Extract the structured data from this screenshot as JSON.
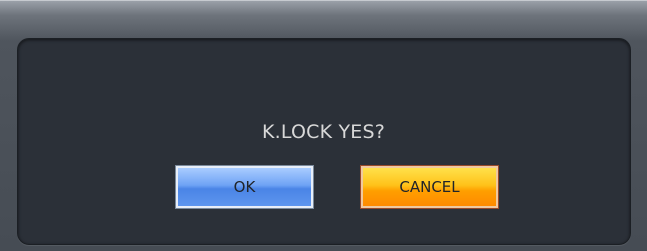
{
  "dialog": {
    "message": "K.LOCK YES?",
    "ok_label": "OK",
    "cancel_label": "CANCEL"
  },
  "colors": {
    "panel": "#2b3038",
    "ok_button": "#5e95ee",
    "cancel_button": "#ffa500",
    "text": "#d8d8d8"
  }
}
